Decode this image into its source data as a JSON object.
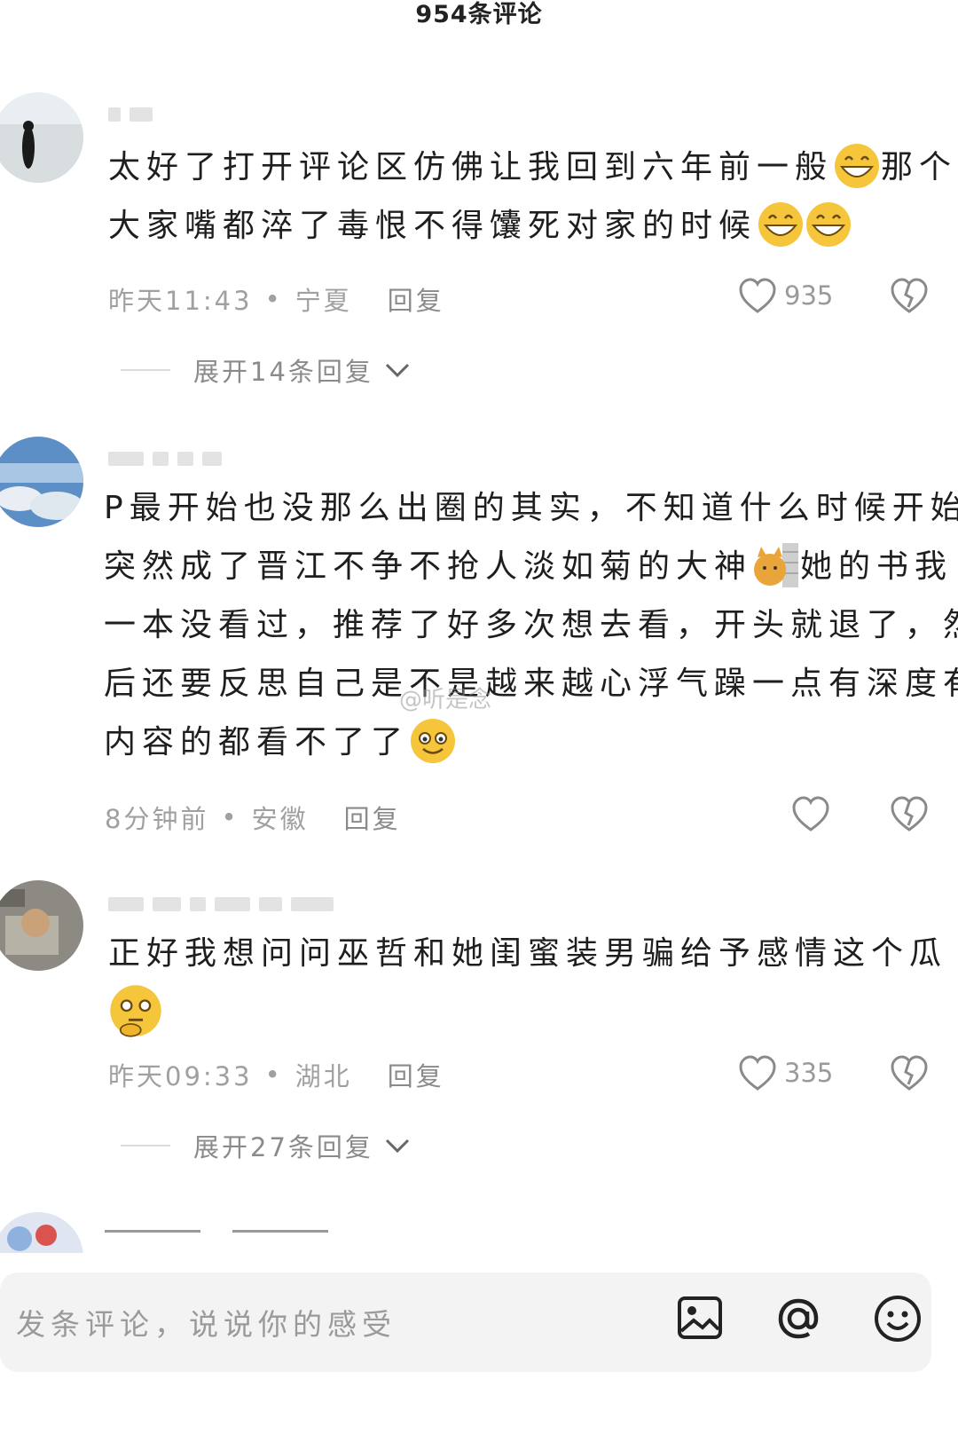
{
  "header": {
    "title": "954条评论"
  },
  "comments": [
    {
      "text_segments": [
        "太好了打开评论区仿佛让我回到六年前一般",
        "那个大家嘴都淬了毒恨不得馕死对家的时候"
      ],
      "emojis": [
        "grin-emoji",
        "grin-emoji",
        "grin-emoji"
      ],
      "time": "昨天11:43",
      "location": "宁夏",
      "reply_label": "回复",
      "likes": "935",
      "expand_label": "展开14条回复"
    },
    {
      "text_segments": [
        "P最开始也没那么出圈的其实，不知道什么时候开始突然成了晋江不争不抢人淡如菊的大神",
        "她的书我一本没看过，推荐了好多次想去看，开头就退了，然后还要反思自己是不是越来越心浮气躁一点有深度有内容的都看不了了"
      ],
      "emojis": [
        "cat-wall-emoji",
        "smile-emoji"
      ],
      "time": "8分钟前",
      "location": "安徽",
      "reply_label": "回复",
      "likes": ""
    },
    {
      "text_segments": [
        "正好我想问问巫哲和她闺蜜装男骗给予感情这个瓜"
      ],
      "emojis": [
        "thinking-emoji"
      ],
      "time": "昨天09:33",
      "location": "湖北",
      "reply_label": "回复",
      "likes": "335",
      "expand_label": "展开27条回复"
    }
  ],
  "input": {
    "placeholder": "发条评论，说说你的感受"
  },
  "icons": [
    "heart-icon",
    "broken-heart-icon",
    "chevron-down-icon",
    "image-icon",
    "at-icon",
    "emoji-icon"
  ],
  "watermark": "@听是念",
  "colors": {
    "text": "#1e1e1e",
    "meta": "#a0a0a0",
    "emoji": "#f5c53b"
  }
}
